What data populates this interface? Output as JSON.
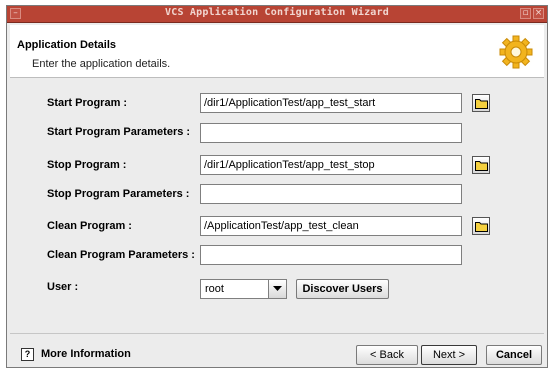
{
  "window": {
    "title": "VCS Application Configuration Wizard",
    "minimize_glyph": "–",
    "restore_glyph": "▫",
    "close_glyph": "×"
  },
  "header": {
    "title": "Application Details",
    "subtitle": "Enter the application details."
  },
  "form": {
    "start_program": {
      "label": "Start Program :",
      "value": "/dir1/ApplicationTest/app_test_start"
    },
    "start_params": {
      "label": "Start Program Parameters :",
      "value": ""
    },
    "stop_program": {
      "label": "Stop Program :",
      "value": "/dir1/ApplicationTest/app_test_stop"
    },
    "stop_params": {
      "label": "Stop Program Parameters :",
      "value": ""
    },
    "clean_program": {
      "label": "Clean Program :",
      "value": "/ApplicationTest/app_test_clean"
    },
    "clean_params": {
      "label": "Clean Program Parameters :",
      "value": ""
    },
    "user": {
      "label": "User :",
      "value": "root"
    }
  },
  "buttons": {
    "discover_users": "Discover Users",
    "back": "< Back",
    "next": "Next >",
    "cancel": "Cancel",
    "more_information": "More Information",
    "help_glyph": "?"
  },
  "icons": {
    "folder": "folder-icon",
    "help": "help-icon",
    "gear": "gear-icon",
    "dropdown": "chevron-down-icon"
  },
  "colors": {
    "titlebar": "#b84434",
    "title_text": "#f1d6d0",
    "gear": "#f2b41e",
    "folder": "#f4d03f"
  }
}
